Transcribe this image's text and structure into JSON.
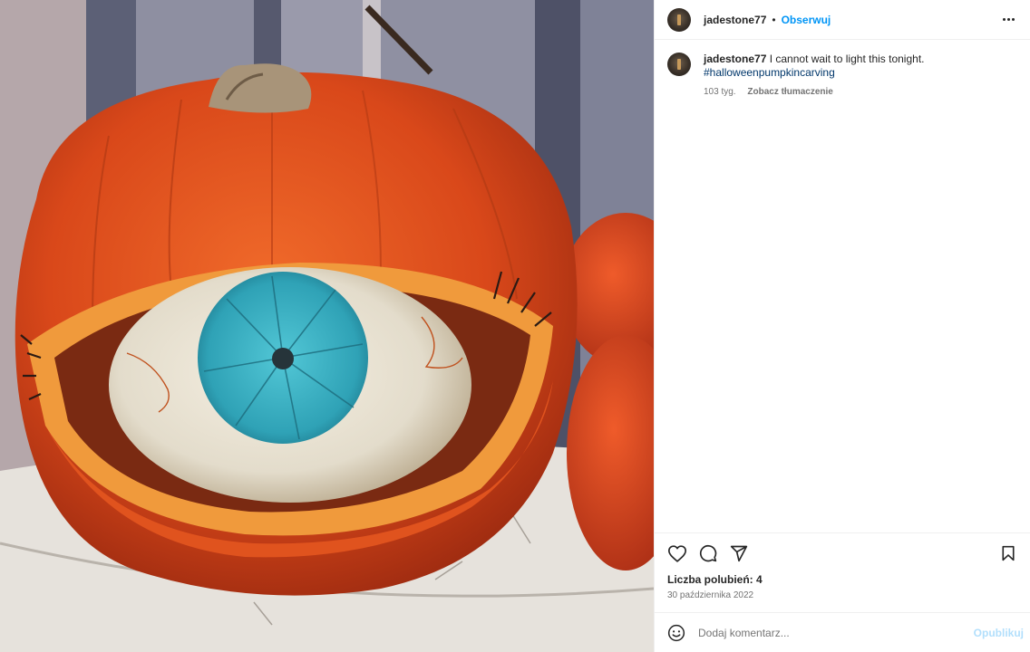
{
  "post": {
    "username": "jadestone77",
    "follow_label": "Obserwuj",
    "separator": "•",
    "caption_text": "I cannot wait to light this tonight.",
    "hashtag": "#halloweenpumpkincarving",
    "age": "103 tyg.",
    "translate_label": "Zobacz tłumaczenie",
    "likes_label": "Liczba polubień: 4",
    "date": "30 października 2022"
  },
  "comment": {
    "placeholder": "Dodaj komentarz...",
    "publish_label": "Opublikuj"
  },
  "icons": {
    "options": "more-horizontal-icon",
    "like": "heart-icon",
    "comment": "comment-bubble-icon",
    "share": "send-arrow-icon",
    "save": "bookmark-icon",
    "emoji": "smiley-icon"
  },
  "colors": {
    "accent": "#0095f6",
    "hashtag": "#00376b",
    "publish_disabled": "#b2dffc",
    "pumpkin": "#e0531e",
    "iris": "#3fb3c4"
  }
}
